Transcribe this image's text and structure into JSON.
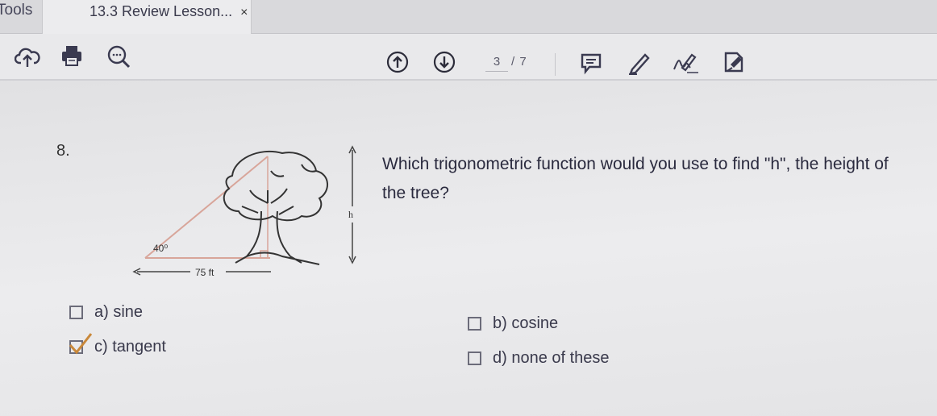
{
  "tabs": {
    "tools_label": "Tools",
    "document_title": "13.3 Review Lesson...",
    "close_glyph": "×"
  },
  "toolbar": {
    "left_icons": [
      "upload-cloud-icon",
      "print-icon",
      "zoom-search-icon"
    ],
    "nav_icons": [
      "previous-page-icon",
      "next-page-icon"
    ],
    "page_current": "3",
    "page_total": "/ 7",
    "right_icons": [
      "comment-icon",
      "highlight-pen-icon",
      "fill-sign-icon",
      "share-edit-icon"
    ]
  },
  "question": {
    "number": "8.",
    "text": "Which trigonometric function would you use to find \"h\", the height of the tree?",
    "figure": {
      "angle_label": "40⁰",
      "base_label": "75 ft",
      "height_label": "h"
    }
  },
  "options": [
    {
      "key": "a",
      "label": "a)  sine",
      "checked": false
    },
    {
      "key": "b",
      "label": "b)  cosine",
      "checked": false
    },
    {
      "key": "c",
      "label": "c)  tangent",
      "checked": true
    },
    {
      "key": "d",
      "label": "d)  none of these",
      "checked": false
    }
  ],
  "colors": {
    "checkmark": "#c9883a",
    "triangle_line": "#d8a59a",
    "nav_icon": "#2c2c3a"
  }
}
